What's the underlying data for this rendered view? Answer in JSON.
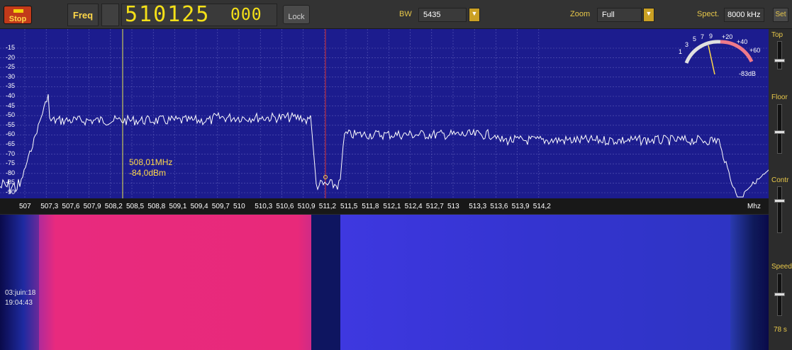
{
  "toolbar": {
    "stop_label": "Stop",
    "freq_label": "Freq",
    "freq_main": "510125",
    "freq_sub": "000",
    "lock_label": "Lock",
    "bw_label": "BW",
    "bw_value": "5435",
    "zoom_label": "Zoom",
    "zoom_value": "Full",
    "spect_label": "Spect.",
    "spect_value": "8000 kHz",
    "set_label": "Set"
  },
  "spectrum": {
    "db_ticks": [
      "-15",
      "-20",
      "-25",
      "-30",
      "-35",
      "-40",
      "-45",
      "-50",
      "-55",
      "-60",
      "-65",
      "-70",
      "-75",
      "-80",
      "-85",
      "-90"
    ],
    "freq_ticks": [
      "507",
      "507,3",
      "507,6",
      "507,9",
      "508,2",
      "508,5",
      "508,8",
      "509,1",
      "509,4",
      "509,7",
      "510",
      "510,3",
      "510,6",
      "510,9",
      "511,2",
      "511,5",
      "511,8",
      "512,1",
      "512,4",
      "512,7",
      "513",
      "513,3",
      "513,6",
      "513,9",
      "514,2"
    ],
    "freq_unit": "Mhz",
    "marker_freq": "508,01MHz",
    "marker_level": "-84,0dBm",
    "meter_scale": [
      "1",
      "3",
      "5",
      "7",
      "9",
      "+20",
      "+40",
      "+60"
    ],
    "meter_reading": "-83dB"
  },
  "waterfall": {
    "date": "03:juin:18",
    "time": "19:04:43"
  },
  "sidebar": {
    "top_label": "Top",
    "floor_label": "Floor",
    "contr_label": "Contr",
    "speed_label": "Speed",
    "speed_value": "78 s"
  },
  "colors": {
    "spectrum_bg": "#1c1c8e",
    "trace": "#ffffff",
    "marker_line": "#e8e84a",
    "center_line": "#d83030",
    "accent": "#ffd84a",
    "waterfall_hot": "#e82a7e",
    "waterfall_cool": "#3232d0"
  }
}
